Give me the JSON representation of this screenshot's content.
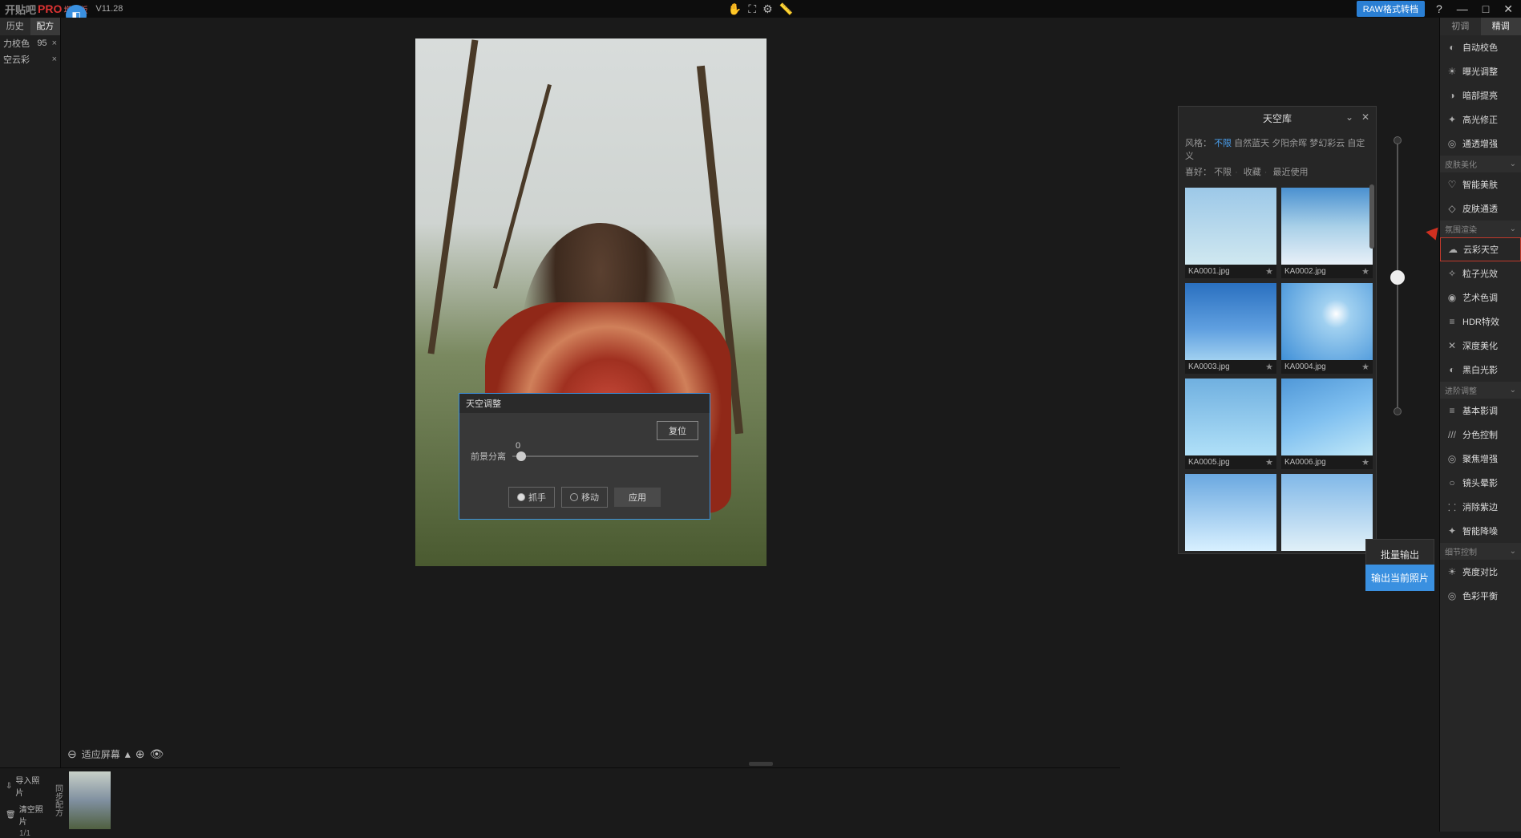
{
  "app": {
    "logo_gray": "开贴吧",
    "logo_pro": "PRO",
    "logo_suffix": "增补版",
    "version": "V11.28"
  },
  "top": {
    "raw_button": "RAW格式转档"
  },
  "left": {
    "tab_history": "历史",
    "tab_preset": "配方",
    "row1": {
      "label": "力校色",
      "value": "95"
    },
    "row2": {
      "label": "空云彩"
    }
  },
  "zoom": {
    "fit_label": "适应屏幕"
  },
  "sky_dialog": {
    "title": "天空调整",
    "reset": "复位",
    "slider_label": "前景分离",
    "slider_value": "0",
    "radio_grab": "抓手",
    "radio_move": "移动",
    "apply": "应用"
  },
  "sky_lib": {
    "title": "天空库",
    "style_label": "风格：",
    "styles": [
      "不限",
      "自然蓝天",
      "夕阳余晖",
      "梦幻彩云",
      "自定义"
    ],
    "fav_label": "喜好：",
    "favs": [
      "不限",
      "收藏",
      "最近使用"
    ],
    "items": [
      {
        "name": "KA0001.jpg"
      },
      {
        "name": "KA0002.jpg"
      },
      {
        "name": "KA0003.jpg"
      },
      {
        "name": "KA0004.jpg"
      },
      {
        "name": "KA0005.jpg"
      },
      {
        "name": "KA0006.jpg"
      }
    ]
  },
  "right": {
    "tab_basic": "初调",
    "tab_fine": "精调",
    "items_main": [
      {
        "icon": "◐",
        "label": "自动校色"
      },
      {
        "icon": "☀",
        "label": "曝光调整"
      },
      {
        "icon": "◑",
        "label": "暗部提亮"
      },
      {
        "icon": "✦",
        "label": "高光修正"
      },
      {
        "icon": "◎",
        "label": "通透增强"
      }
    ],
    "sec_skin": "皮肤美化",
    "items_skin": [
      {
        "icon": "♡",
        "label": "智能美肤"
      },
      {
        "icon": "◇",
        "label": "皮肤通透"
      }
    ],
    "sec_atmo": "氛围渲染",
    "items_atmo": [
      {
        "icon": "☁",
        "label": "云彩天空"
      },
      {
        "icon": "✧",
        "label": "粒子光效"
      },
      {
        "icon": "◉",
        "label": "艺术色调"
      },
      {
        "icon": "≡",
        "label": "HDR特效"
      },
      {
        "icon": "✕",
        "label": "深度美化"
      },
      {
        "icon": "◐",
        "label": "黑白光影"
      }
    ],
    "sec_adv": "进阶调整",
    "items_adv": [
      {
        "icon": "≡",
        "label": "基本影调"
      },
      {
        "icon": "///",
        "label": "分色控制"
      },
      {
        "icon": "◎",
        "label": "聚焦增强"
      },
      {
        "icon": "○",
        "label": "镜头晕影"
      },
      {
        "icon": "⸬",
        "label": "消除紫边"
      },
      {
        "icon": "✦",
        "label": "智能降噪"
      }
    ],
    "sec_detail": "细节控制",
    "items_detail": [
      {
        "icon": "☀",
        "label": "亮度对比"
      },
      {
        "icon": "◎",
        "label": "色彩平衡"
      }
    ]
  },
  "output": {
    "batch": "批量输出",
    "export": "输出当前照片"
  },
  "bottom": {
    "import": "导入照片",
    "clear": "清空照片",
    "page": "1/1",
    "sync": "同步配方"
  }
}
